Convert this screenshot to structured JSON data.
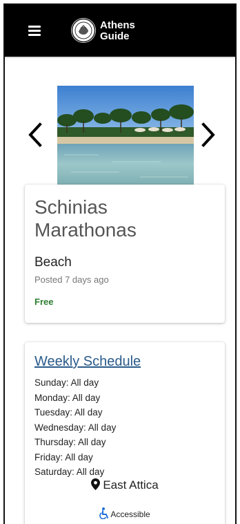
{
  "header": {
    "brand_line1": "Athens",
    "brand_line2": "Guide",
    "menu_icon": "hamburger-icon",
    "logo_icon": "athens-guide-logo"
  },
  "carousel": {
    "image": "beach-photo",
    "prev_icon": "chevron-left-icon",
    "next_icon": "chevron-right-icon"
  },
  "listing": {
    "title": "Schinias Marathonas",
    "category": "Beach",
    "posted": "Posted 7 days ago",
    "price": "Free"
  },
  "schedule": {
    "title": "Weekly Schedule",
    "days": [
      "Sunday: All day",
      "Monday: All day",
      "Tuesday: All day",
      "Wednesday: All day",
      "Thursday: All day",
      "Friday: All day",
      "Saturday: All day"
    ]
  },
  "location": {
    "text": "East Attica",
    "icon": "map-pin-icon"
  },
  "accessibility": {
    "text": "Accessible",
    "icon": "wheelchair-icon"
  },
  "colors": {
    "header_bg": "#000000",
    "price": "#2e7d32",
    "link": "#2a5a8a",
    "accessible_icon": "#1e6fd9"
  }
}
